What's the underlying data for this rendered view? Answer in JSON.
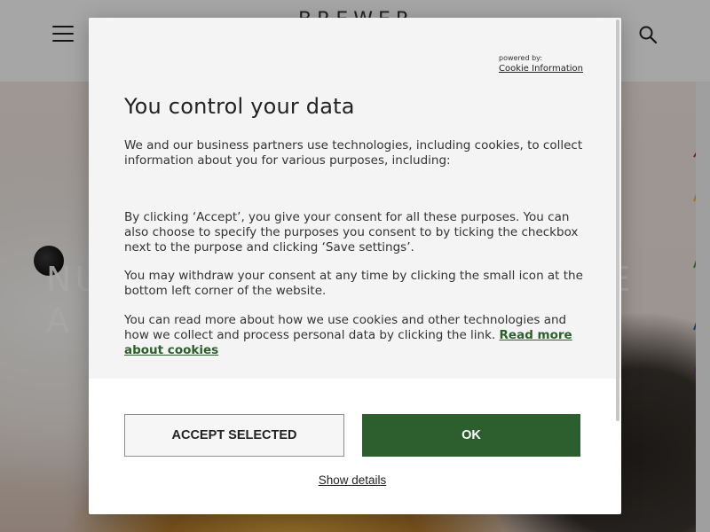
{
  "site": {
    "logo_text": "BREWER",
    "hero_title_lines": [
      "NU",
      "A D"
    ],
    "hero_title_right": "E"
  },
  "consent": {
    "powered_by_label": "powered by:",
    "powered_by_link": "Cookie Information",
    "title": "You control your data",
    "intro": "We and our business partners use technologies, including cookies, to collect information about you for various purposes, including:",
    "consent_text": "By clicking ‘Accept’, you give your consent for all these purposes. You can also choose to specify the purposes you consent to by ticking the checkbox next to the purpose and clicking ‘Save settings’.",
    "withdraw_text": "You may withdraw your consent at any time by clicking the small icon at the bottom left corner of the website.",
    "read_more_text": "You can read more about how we use cookies and other technologies and how we collect and process personal data by clicking the link.",
    "read_more_link": "Read more about cookies",
    "accept_selected_label": "ACCEPT SELECTED",
    "ok_label": "OK",
    "show_details_label": "Show details"
  },
  "colors": {
    "primary_green": "#2d5f2e",
    "modal_body_bg": "#f4f4f4",
    "overlay": "rgba(0,0,0,0.35)"
  },
  "icons": {
    "menu": "hamburger-menu-icon",
    "search": "search-icon"
  }
}
